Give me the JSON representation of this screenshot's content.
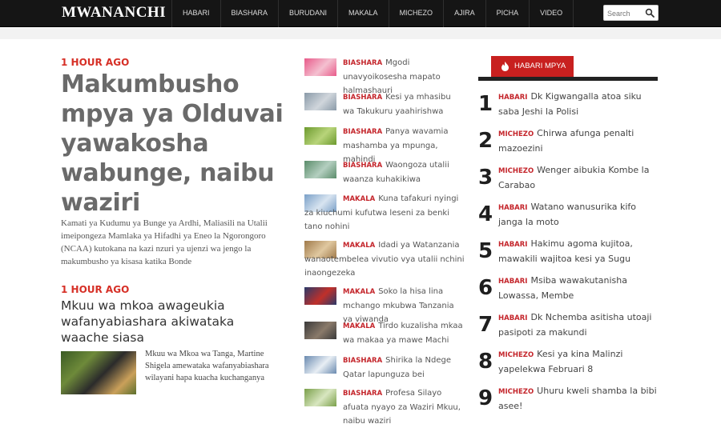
{
  "header": {
    "logo": "MWANANCHI",
    "nav": [
      "HABARI",
      "BIASHARA",
      "BURUDANI",
      "MAKALA",
      "MICHEZO",
      "AJIRA",
      "PICHA",
      "VIDEO"
    ],
    "search_placeholder": "Search"
  },
  "lead": {
    "time": "1 HOUR AGO",
    "headline": "Makumbusho mpya ya Olduvai yawakosha wabunge, naibu waziri",
    "summary": " Kamati ya Kudumu ya Bunge ya Ardhi, Maliasili na Utalii imeipongeza Mamlaka ya Hifadhi ya Eneo la Ngorongoro (NCAA) kutokana na kazi nzuri ya ujenzi wa jengo la makumbusho ya kisasa katika Bonde"
  },
  "second": {
    "time": "1 HOUR AGO",
    "headline": "Mkuu wa mkoa awageukia wafanyabiashara akiwataka waache siasa",
    "summary": "Mkuu wa Mkoa wa Tanga, Martine Shigela amewataka wafanyabiashara wilayani hapa kuacha kuchanganya"
  },
  "mid_list": [
    {
      "category": "BIASHARA",
      "text": "Mgodi unavyoikosesha mapato halmashauri",
      "thumb": [
        "#e85a8a",
        "#f4c0d0"
      ]
    },
    {
      "category": "BIASHARA",
      "text": "Kesi ya mhasibu wa Takukuru yaahirishwa",
      "thumb": [
        "#8a9aa8",
        "#d0d6dc"
      ]
    },
    {
      "category": "BIASHARA",
      "text": "Panya wavamia mashamba ya mpunga, mahindi",
      "thumb": [
        "#6c9a2e",
        "#b8d47a"
      ]
    },
    {
      "category": "BIASHARA",
      "text": "Waongoza utalii waanza kuhakikiwa",
      "thumb": [
        "#5a8c6a",
        "#b4cfc0"
      ]
    },
    {
      "category": "MAKALA",
      "text": "Kuna tafakuri nyingi za kiuchumi kufutwa leseni za benki tano nohini",
      "thumb": [
        "#7aa0c8",
        "#d8e4f0"
      ]
    },
    {
      "category": "MAKALA",
      "text": "Idadi ya Watanzania wanaotembelea vivutio vya utalii nchini inaongezeka",
      "thumb": [
        "#a07a4a",
        "#e0c8a0"
      ]
    },
    {
      "category": "MAKALA",
      "text": "Soko la hisa lina mchango mkubwa Tanzania ya viwanda",
      "thumb": [
        "#2a3a6a",
        "#c0302a"
      ]
    },
    {
      "category": "MAKALA",
      "text": "Tirdo kuzalisha mkaa wa makaa ya mawe Machi",
      "thumb": [
        "#3a3a3a",
        "#8a7a6a"
      ]
    },
    {
      "category": "BIASHARA",
      "text": "Shirika la Ndege Qatar lapunguza bei",
      "thumb": [
        "#6a8ab0",
        "#e8eef4"
      ]
    },
    {
      "category": "BIASHARA",
      "text": "Profesa Silayo afuata nyayo za Waziri Mkuu, naibu waziri",
      "thumb": [
        "#7aa04a",
        "#d8e6c0"
      ]
    }
  ],
  "habari_mpya": {
    "title": "HABARI MPYA",
    "items": [
      {
        "num": "1",
        "category": "HABARI",
        "text": "Dk Kigwangalla atoa siku saba Jeshi la Polisi"
      },
      {
        "num": "2",
        "category": "MICHEZO",
        "text": "Chirwa afunga penalti mazoezini"
      },
      {
        "num": "3",
        "category": "MICHEZO",
        "text": "Wenger aibukia Kombe la Carabao"
      },
      {
        "num": "4",
        "category": "HABARI",
        "text": "Watano wanusurika kifo janga la moto"
      },
      {
        "num": "5",
        "category": "HABARI",
        "text": "Hakimu agoma kujitoa, mawakili wajitoa kesi ya Sugu"
      },
      {
        "num": "6",
        "category": "HABARI",
        "text": "Msiba wawakutanisha Lowassa, Membe"
      },
      {
        "num": "7",
        "category": "HABARI",
        "text": "Dk Nchemba asitisha utoaji pasipoti za makundi"
      },
      {
        "num": "8",
        "category": "MICHEZO",
        "text": "Kesi ya kina Malinzi yapelekwa Februari 8"
      },
      {
        "num": "9",
        "category": "MICHEZO",
        "text": "Uhuru kweli shamba la bibi asee!"
      }
    ]
  },
  "colors": {
    "accent": "#c4252b",
    "topbar": "#151515",
    "tab": "#c8201f"
  }
}
